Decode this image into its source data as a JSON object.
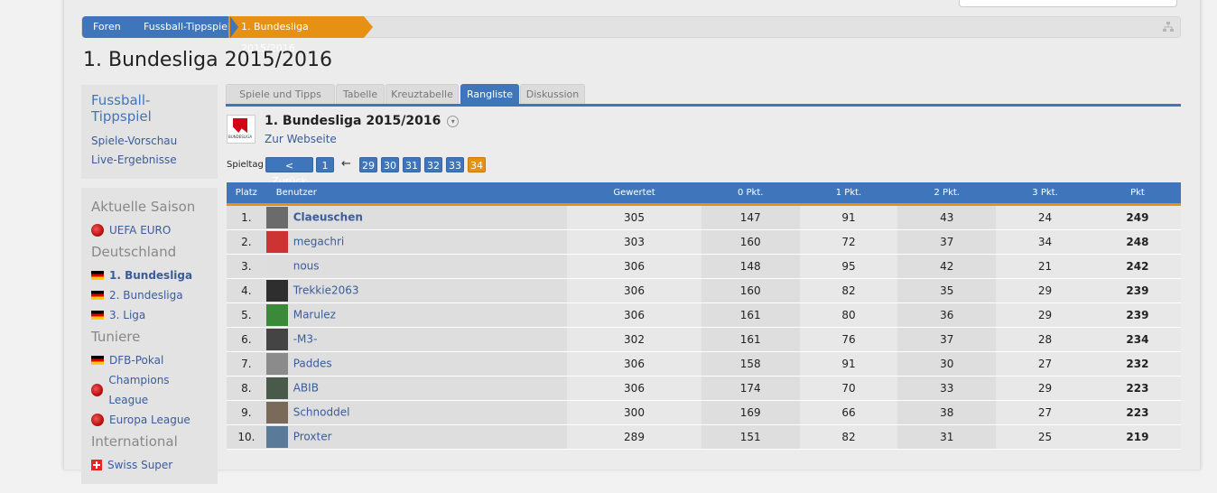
{
  "breadcrumb": [
    "Foren",
    "Fussball-Tippspiel",
    "1. Bundesliga 2015/2016"
  ],
  "page_title": "1. Bundesliga 2015/2016",
  "sidebar": {
    "box_title": "Fussball-Tippspiel",
    "links": [
      "Spiele-Vorschau",
      "Live-Ergebnisse"
    ],
    "sections": [
      {
        "title": "Aktuelle Saison",
        "items": [
          {
            "icon": "uefa-icon",
            "label": "UEFA EURO"
          }
        ]
      },
      {
        "title": "Deutschland",
        "items": [
          {
            "icon": "flag-germany-icon",
            "label": "1. Bundesliga",
            "active": true
          },
          {
            "icon": "flag-germany-icon",
            "label": "2. Bundesliga"
          },
          {
            "icon": "flag-germany-icon",
            "label": "3. Liga"
          }
        ]
      },
      {
        "title": "Tuniere",
        "items": [
          {
            "icon": "flag-germany-icon",
            "label": "DFB-Pokal"
          },
          {
            "icon": "uefa-icon",
            "label": "Champions League"
          },
          {
            "icon": "uefa-icon",
            "label": "Europa League"
          }
        ]
      },
      {
        "title": "International",
        "items": [
          {
            "icon": "flag-switzerland-icon",
            "label": "Swiss Super"
          }
        ]
      }
    ]
  },
  "tabs": [
    "Spiele und Tipps",
    "Tabelle",
    "Kreuztabelle",
    "Rangliste",
    "Diskussion"
  ],
  "active_tab": "Rangliste",
  "league": {
    "title": "1. Bundesliga 2015/2016",
    "dropdown_glyph": "▾",
    "link": "Zur Webseite"
  },
  "spieltag": {
    "label": "Spieltag",
    "back": "< Zurück",
    "first": "1",
    "arrow": "←",
    "days": [
      "29",
      "30",
      "31",
      "32",
      "33",
      "34"
    ],
    "current": "34"
  },
  "table": {
    "headers": [
      "Platz",
      "Benutzer",
      "Gewertet",
      "0 Pkt.",
      "1 Pkt.",
      "2 Pkt.",
      "3 Pkt.",
      "Pkt"
    ],
    "rows": [
      [
        "1.",
        "Claeuschen",
        "305",
        "147",
        "91",
        "43",
        "24",
        "249"
      ],
      [
        "2.",
        "megachri",
        "303",
        "160",
        "72",
        "37",
        "34",
        "248"
      ],
      [
        "3.",
        "nous",
        "306",
        "148",
        "95",
        "42",
        "21",
        "242"
      ],
      [
        "4.",
        "Trekkie2063",
        "306",
        "160",
        "82",
        "35",
        "29",
        "239"
      ],
      [
        "5.",
        "Marulez",
        "306",
        "161",
        "80",
        "36",
        "29",
        "239"
      ],
      [
        "6.",
        "-M3-",
        "302",
        "161",
        "76",
        "37",
        "28",
        "234"
      ],
      [
        "7.",
        "Paddes",
        "306",
        "158",
        "91",
        "30",
        "27",
        "232"
      ],
      [
        "8.",
        "ABIB",
        "306",
        "174",
        "70",
        "33",
        "29",
        "223"
      ],
      [
        "9.",
        "Schnoddel",
        "300",
        "169",
        "66",
        "38",
        "27",
        "223"
      ],
      [
        "10.",
        "Proxter",
        "289",
        "151",
        "82",
        "31",
        "25",
        "219"
      ]
    ]
  },
  "colors": {
    "accent": "#3f76bb",
    "highlight": "#e69113"
  }
}
